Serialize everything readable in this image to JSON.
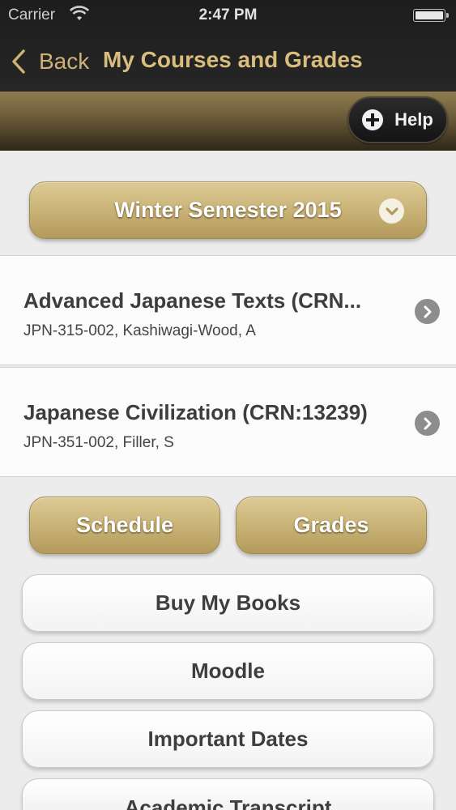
{
  "status_bar": {
    "carrier": "Carrier",
    "time": "2:47 PM"
  },
  "nav": {
    "back_label": "Back",
    "title": "My Courses and Grades"
  },
  "help": {
    "label": "Help"
  },
  "semester": {
    "label": "Winter Semester 2015"
  },
  "courses": [
    {
      "title": "Advanced Japanese Texts (CRN...",
      "subtitle": "JPN-315-002, Kashiwagi-Wood, A"
    },
    {
      "title": "Japanese Civilization (CRN:13239)",
      "subtitle": "JPN-351-002, Filler, S"
    }
  ],
  "actions": {
    "schedule_label": "Schedule",
    "grades_label": "Grades"
  },
  "links": [
    {
      "label": "Buy My Books"
    },
    {
      "label": "Moodle"
    },
    {
      "label": "Important Dates"
    },
    {
      "label": "Academic Transcript"
    }
  ],
  "colors": {
    "nav_background": "#1d1d1d",
    "accent_gold": "#c9b377",
    "nav_title": "#d8bd7d",
    "page_background": "#ececec"
  }
}
